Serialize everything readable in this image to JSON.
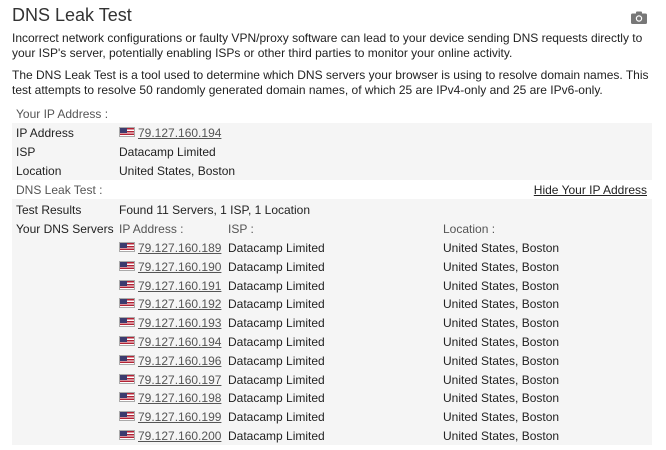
{
  "page": {
    "title": "DNS Leak Test",
    "intro1": "Incorrect network configurations or faulty VPN/proxy software can lead to your device sending DNS requests directly to your ISP's server, potentially enabling ISPs or other third parties to monitor your online activity.",
    "intro2": "The DNS Leak Test is a tool used to determine which DNS servers your browser is using to resolve domain names. This test attempts to resolve 50 randomly generated domain names, of which 25 are IPv4-only and 25 are IPv6-only."
  },
  "your_ip": {
    "header": "Your IP Address :",
    "ip_label": "IP Address",
    "ip_value": "79.127.160.194",
    "isp_label": "ISP",
    "isp_value": "Datacamp Limited",
    "location_label": "Location",
    "location_value": "United States, Boston"
  },
  "dns_test": {
    "header": "DNS Leak Test :",
    "hide_link": "Hide Your IP Address",
    "results_label": "Test Results",
    "results_value": "Found 11 Servers, 1 ISP, 1 Location",
    "servers_label": "Your DNS Servers",
    "col_ip": "IP Address :",
    "col_isp": "ISP :",
    "col_location": "Location :",
    "servers": [
      {
        "ip": "79.127.160.189",
        "isp": "Datacamp Limited",
        "location": "United States, Boston"
      },
      {
        "ip": "79.127.160.190",
        "isp": "Datacamp Limited",
        "location": "United States, Boston"
      },
      {
        "ip": "79.127.160.191",
        "isp": "Datacamp Limited",
        "location": "United States, Boston"
      },
      {
        "ip": "79.127.160.192",
        "isp": "Datacamp Limited",
        "location": "United States, Boston"
      },
      {
        "ip": "79.127.160.193",
        "isp": "Datacamp Limited",
        "location": "United States, Boston"
      },
      {
        "ip": "79.127.160.194",
        "isp": "Datacamp Limited",
        "location": "United States, Boston"
      },
      {
        "ip": "79.127.160.196",
        "isp": "Datacamp Limited",
        "location": "United States, Boston"
      },
      {
        "ip": "79.127.160.197",
        "isp": "Datacamp Limited",
        "location": "United States, Boston"
      },
      {
        "ip": "79.127.160.198",
        "isp": "Datacamp Limited",
        "location": "United States, Boston"
      },
      {
        "ip": "79.127.160.199",
        "isp": "Datacamp Limited",
        "location": "United States, Boston"
      },
      {
        "ip": "79.127.160.200",
        "isp": "Datacamp Limited",
        "location": "United States, Boston"
      }
    ]
  },
  "icons": {
    "camera": "camera-icon",
    "flag": "us-flag-icon"
  },
  "colors": {
    "panel_bg": "#f5f5f5",
    "link": "#555555"
  }
}
